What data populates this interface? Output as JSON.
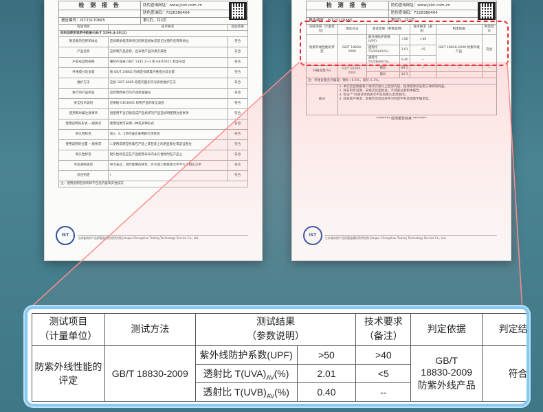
{
  "report": {
    "title": "检 测 报 告",
    "website_label": "防伪查询网址：www.jsist.com.cn",
    "code_label": "防伪查询码：7328380404",
    "code_label_right": "防伪查询码：7328380404",
    "report_no": "报告编号：IST23170665",
    "page_left": "第2页，共3页",
    "page_right": "第3页，共3页",
    "lab_name": "江苏省纺织产品质量监督检验研究院 Jiangsu Changzhou Testing Technology Service Co., Ltd.",
    "stamp": "IST"
  },
  "left_table": {
    "headers": [
      "检验项目",
      "技术要求",
      "检验结果"
    ],
    "section": "纺织品使用说明书检查(GB/T 5296.4-2012)",
    "rows": [
      [
        "制造者的名称和地址",
        "应标明承担法律责任的制造者依法登记注册的名称和地址",
        "符合"
      ],
      [
        "产品名称",
        "应标明产品名称，且表明产品的真实属性",
        "符合"
      ],
      [
        "产品号型和规格",
        "服装产品按 GB/T 1335.1~3 或 GB/T6411 标注号型",
        "符合"
      ],
      [
        "纤维成分及含量",
        "按 GB/T 29862 的规定标明其纤维成分及含量",
        "符合"
      ],
      [
        "维护方法",
        "应按 GB/T 8685 规定的图形符号表述维护方法",
        "符合"
      ],
      [
        "执行的产品标准",
        "应标明所执行的产品标准编号",
        "符合"
      ],
      [
        "安全技术类别",
        "应根据 GB18401 标明产品的安全类别",
        "符合"
      ],
      [
        "使用和贮藏注意事项",
        "因使用不当可能造成产品损坏的产品宜标明使用注意事项",
        "符合"
      ],
      [
        "使用说明的形式 一般要求",
        "使用说明可采用一种或多种形式",
        "符合"
      ],
      [
        "耐久性标签",
        "第3、4、5项内容应采用耐久性标签",
        "符合"
      ],
      [
        "使用说明的位置 一般要求",
        "1.使用说明应附着在产品上或包装上的明显部位或适当部位",
        "符合"
      ],
      [
        "耐久性标签",
        "耐久性标签应在产品使用寿命内永久性地附在产品上",
        "符合"
      ],
      [
        "字迹清晰规范",
        "中文表达，同时使用的拼音、外文或少数民族文字不大于相应汉字",
        "符合"
      ],
      [
        "综合判定",
        "/",
        "符合"
      ]
    ],
    "note": "注：使用说明检测项目不包括内容真实性核实"
  },
  "right_table": {
    "headers": [
      "测试项目（计量单位）",
      "测试方法",
      "测试结果（参数说明）",
      "技术要求（备注）",
      "判定依据",
      "判定结论"
    ],
    "row": {
      "item": "防紫外线性能的评定",
      "method": "GB/T 18830-2009",
      "results": [
        {
          "name": "紫外线防护系数(UPF)",
          "value": ">50",
          "req": ">40"
        },
        {
          "name": "透射比 T(UVA)AV(%)",
          "value": "2.01",
          "req": "<5"
        },
        {
          "name": "透射比 T(UVB)AV(%)",
          "value": "0.40",
          "req": "--"
        }
      ],
      "basis": "GB/T 18830-2009 防紫外线产品",
      "conclusion": "符合"
    },
    "fiber": {
      "item": "纤维含量(%)",
      "method": "FZ/T 01095-2002",
      "rows": [
        [
          "锦纶",
          "89.5"
        ],
        [
          "氨纶",
          "10.5"
        ]
      ],
      "note": "注：纤维含量允许偏差：锦纶+0.6%，氨纶-1.3%。"
    },
    "remarks_label": "备注",
    "remarks": [
      "1. 本实验室根据客户要求实施以上检测内容，检测结果仅适用于收到的样品。",
      "2. 除非另有说明，未经实验室批准，不得部分复制本报告。",
      "3. 标记\"*\"的测试项目表示不在资质认定范围内。",
      "4. 除非客户要求，本报告的测试条件为判定不考虑测量不确定度。"
    ],
    "end": "******** 检测报告结束 ********"
  },
  "zoom": {
    "h1": "测试项目",
    "h1b": "（计量单位）",
    "h2": "测试方法",
    "h3": "测试结果",
    "h3b": "（参数说明）",
    "h4": "技术要求",
    "h4b": "（备注）",
    "h5": "判定依据",
    "h6": "判定结论",
    "item_a": "防紫外线性能的",
    "item_b": "评定",
    "method": "GB/T 18830-2009",
    "r1_name": "紫外线防护系数(UPF)",
    "r1_val": ">50",
    "r1_req": ">40",
    "r2_pre": "透射比 T(UVA)",
    "r2_sub": "AV",
    "r2_post": "(%)",
    "r2_val": "2.01",
    "r2_req": "<5",
    "r3_pre": "透射比 T(UVB)",
    "r3_sub": "AV",
    "r3_post": "(%)",
    "r3_val": "0.40",
    "r3_req": "--",
    "basis_a": "GB/T",
    "basis_b": "18830-2009",
    "basis_c": "防紫外线产品",
    "conclusion": "符合"
  },
  "colors": {
    "highlight": "#e8262c",
    "frame": "#86c9f2",
    "background": "#4a8392"
  }
}
